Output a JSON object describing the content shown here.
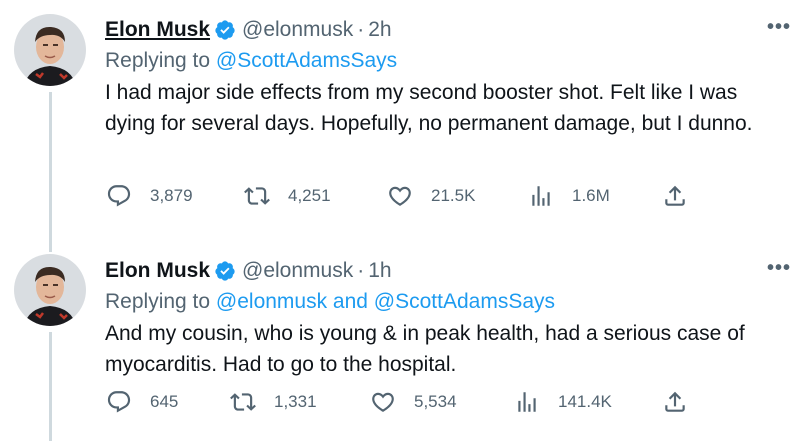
{
  "tweets": [
    {
      "name": "Elon Musk",
      "handle": "@elonmusk",
      "separator": "·",
      "time": "2h",
      "reply_prefix": "Replying to",
      "reply_to": "@ScottAdamsSays",
      "text": "I had major side effects from my second booster shot. Felt like I was dying for several days. Hopefully, no permanent damage, but I dunno.",
      "more": "•••",
      "stats": {
        "replies": "3,879",
        "retweets": "4,251",
        "likes": "21.5K",
        "views": "1.6M"
      }
    },
    {
      "name": "Elon Musk",
      "handle": "@elonmusk",
      "separator": "·",
      "time": "1h",
      "reply_prefix": "Replying to",
      "reply_to": "@elonmusk and @ScottAdamsSays",
      "text": "And my cousin, who is young & in peak health, had a serious case of myocarditis. Had to go to the hospital.",
      "more": "•••",
      "stats": {
        "replies": "645",
        "retweets": "1,331",
        "likes": "5,534",
        "views": "141.4K"
      }
    }
  ],
  "colors": {
    "link": "#1d9bf0",
    "secondary_text": "#536471",
    "primary_text": "#0f1419",
    "verified": "#1d9bf0",
    "thread_line": "#cfd9de"
  }
}
